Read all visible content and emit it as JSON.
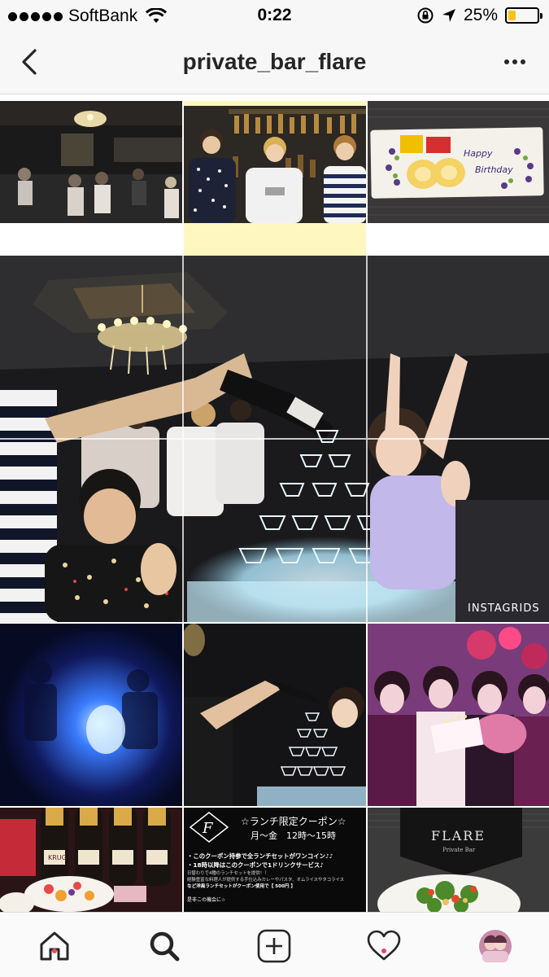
{
  "status_bar": {
    "carrier": "SoftBank",
    "time": "0:22",
    "battery_percent": "25%",
    "battery_level": 0.25
  },
  "nav": {
    "title": "private_bar_flare"
  },
  "posts": {
    "birthday_plate_text_1": "Happy",
    "birthday_plate_text_2": "Birthday",
    "watermark": "INSTAGRIDS",
    "coupon": {
      "title": "☆ランチ限定クーポン☆",
      "days_hours": "月～金　12時～15時",
      "line1": "・このクーポン持参で全ランチセットがワンコイン♪♪",
      "line2": "・18時以降はこのクーポンで1ドリンクサービス♪",
      "line3": "日替わりで4種のランチセットを提供！！",
      "line4": "経験豊富な料理人が提供する手仕込みカレーやパスタ、オムライスやタコライス",
      "line5": "など洋風ランチセットがクーポン使用で【 500円 】",
      "line6": "是非この機会に☆"
    },
    "flare_sign": "FLARE",
    "flare_sign_sub": "Private Bar",
    "krug_label": "KRUG"
  },
  "tabs": [
    "home",
    "search",
    "new-post",
    "activity",
    "profile"
  ],
  "colors": {
    "accent_dot": "#ed4956",
    "battery": "#f5c518"
  }
}
